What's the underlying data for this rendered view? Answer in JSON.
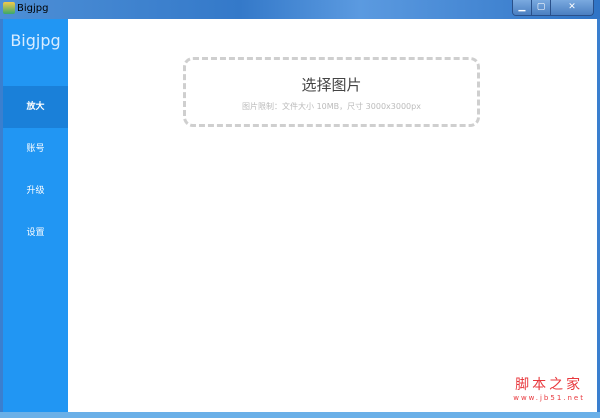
{
  "window": {
    "title": "Bigjpg",
    "minimize": "▁",
    "maximize": "▢",
    "close": "✕"
  },
  "sidebar": {
    "logo": "Bigjpg",
    "items": [
      {
        "label": "放大",
        "active": true
      },
      {
        "label": "账号"
      },
      {
        "label": "升级"
      },
      {
        "label": "设置"
      }
    ]
  },
  "main": {
    "upload_title": "选择图片",
    "upload_hint": "图片限制：文件大小 10MB，尺寸 3000x3000px"
  },
  "watermark": {
    "line1": "脚本之家",
    "line2": "www.jb51.net"
  }
}
